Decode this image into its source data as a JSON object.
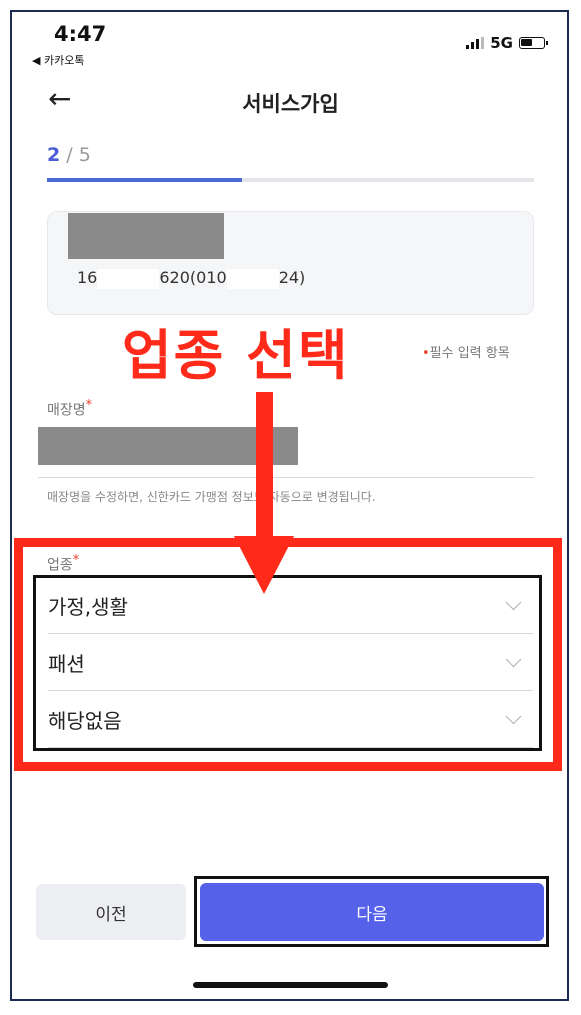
{
  "status_bar": {
    "time": "4:47",
    "back_app": "◀ 카카오톡",
    "network": "5G"
  },
  "header": {
    "back_glyph": "←",
    "title": "서비스가입"
  },
  "progress": {
    "current": "2",
    "separator": " / ",
    "total": "5",
    "fraction": 0.4
  },
  "card": {
    "number_prefix": "16",
    "number_mid": "620(010",
    "number_suffix": "24)"
  },
  "annotation": {
    "headline": "업종 선택"
  },
  "form": {
    "required_note": "필수 입력 항목",
    "required_mark": "•",
    "store_label": "매장명",
    "store_hint": "매장명을 수정하면, 신한카드 가맹점 정보도 자동으로 변경됩니다.",
    "industry_label": "업종",
    "industry_options": [
      "가정,생활",
      "패션",
      "해당없음"
    ]
  },
  "footer": {
    "prev_label": "이전",
    "next_label": "다음"
  },
  "colors": {
    "accent": "#5561e8",
    "annotation_red": "#ff2a1a",
    "required": "#e8452c"
  }
}
